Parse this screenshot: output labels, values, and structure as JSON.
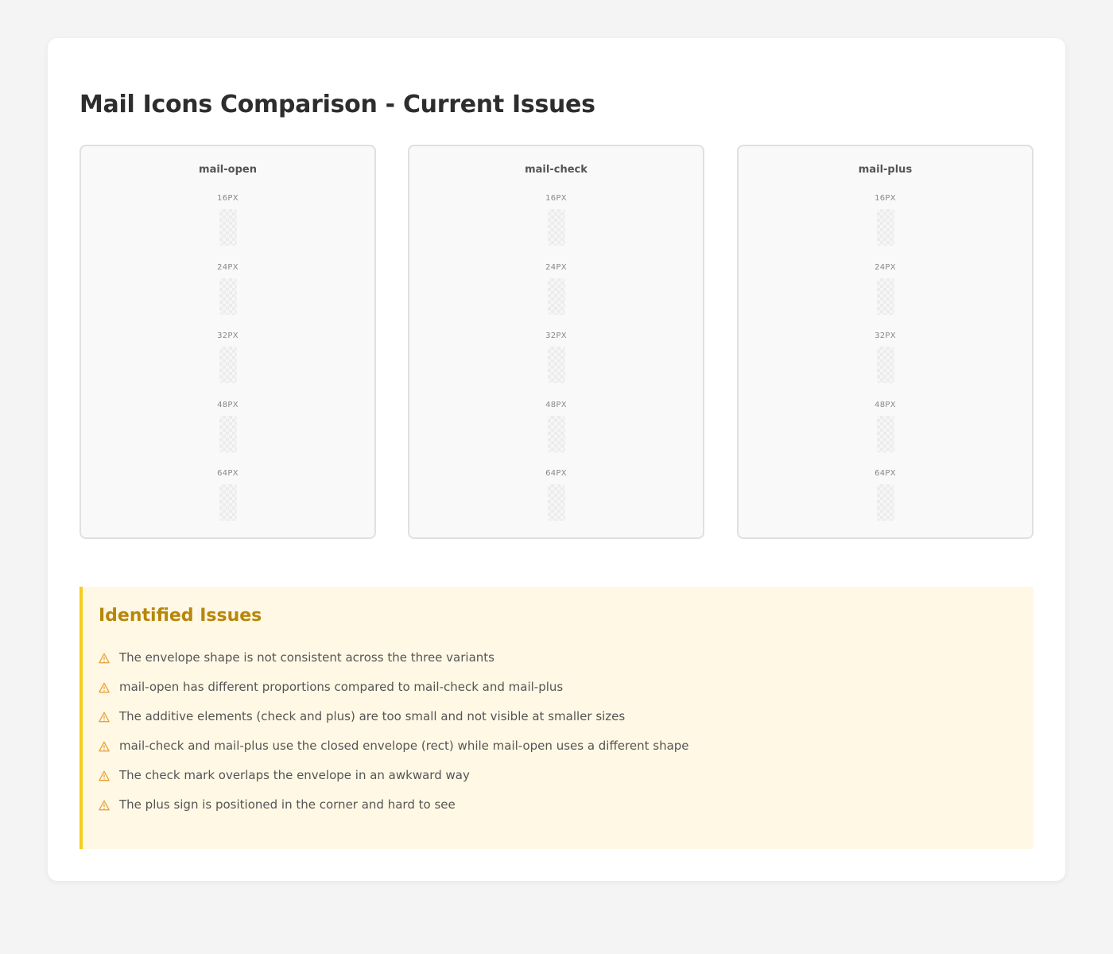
{
  "page": {
    "title": "Mail Icons Comparison - Current Issues"
  },
  "variants": [
    {
      "name": "mail-open",
      "sizes": [
        "16PX",
        "24PX",
        "32PX",
        "48PX",
        "64PX"
      ]
    },
    {
      "name": "mail-check",
      "sizes": [
        "16PX",
        "24PX",
        "32PX",
        "48PX",
        "64PX"
      ]
    },
    {
      "name": "mail-plus",
      "sizes": [
        "16PX",
        "24PX",
        "32PX",
        "48PX",
        "64PX"
      ]
    }
  ],
  "issues": {
    "title": "Identified Issues",
    "icon": "warning-icon",
    "accent_color": "#f5cd1a",
    "items": [
      "The envelope shape is not consistent across the three variants",
      "mail-open has different proportions compared to mail-check and mail-plus",
      "The additive elements (check and plus) are too small and not visible at smaller sizes",
      "mail-check and mail-plus use the closed envelope (rect) while mail-open uses a different shape",
      "The check mark overlaps the envelope in an awkward way",
      "The plus sign is positioned in the corner and hard to see"
    ]
  }
}
